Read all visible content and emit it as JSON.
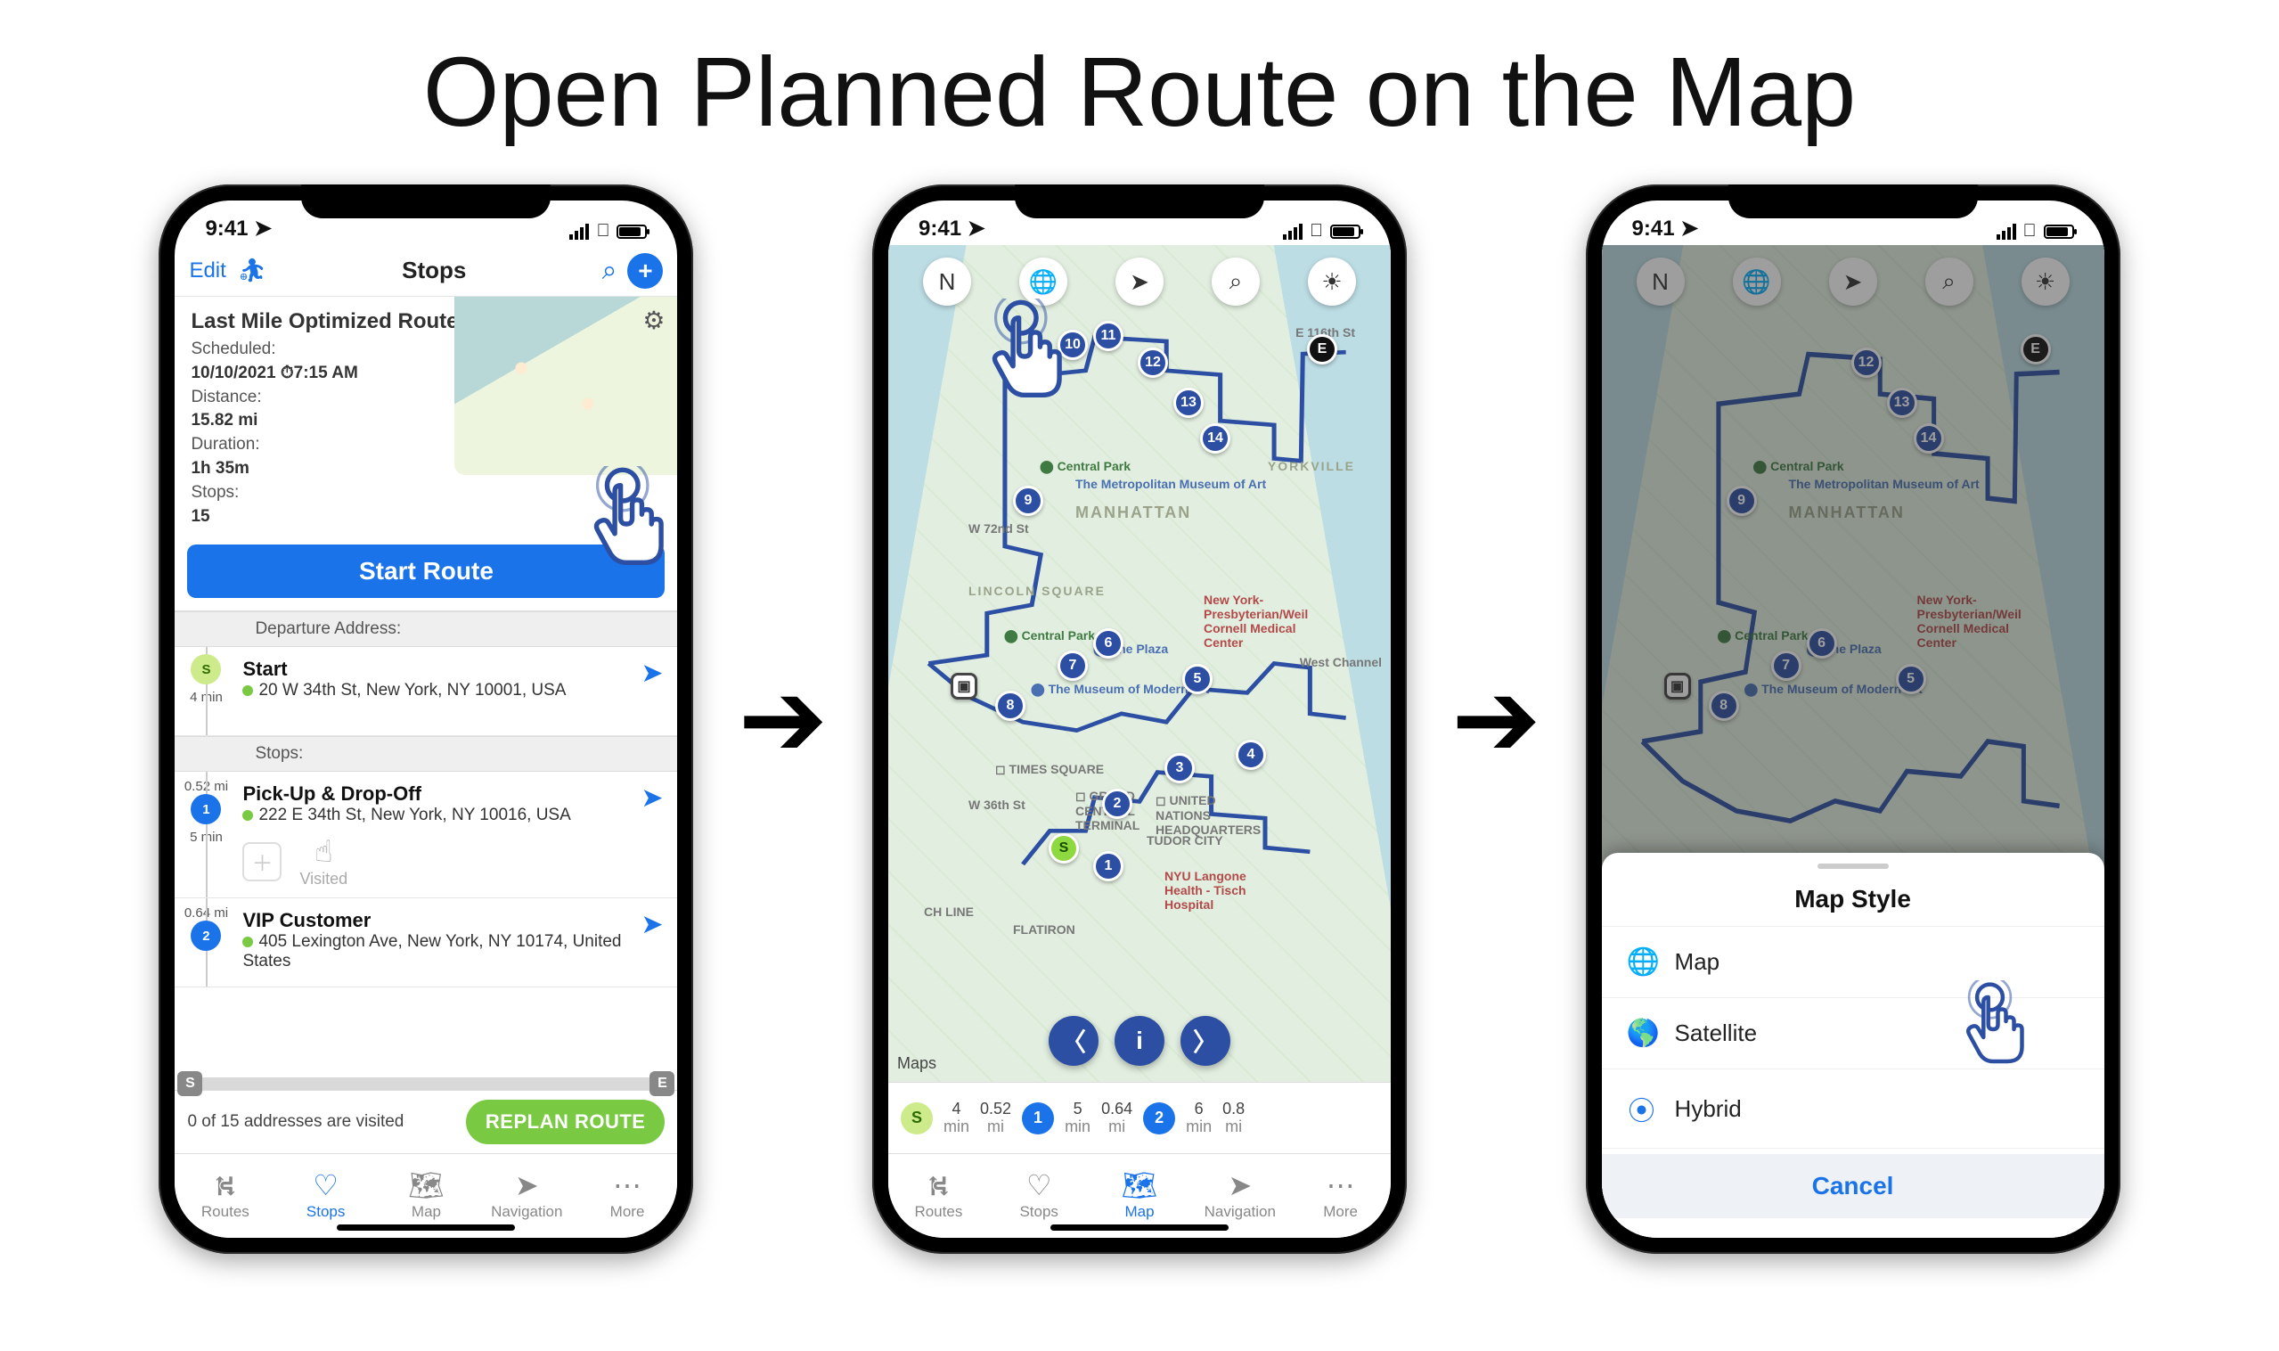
{
  "page_title": "Open Planned Route on the Map",
  "status": {
    "time": "9:41"
  },
  "screen1": {
    "toolbar": {
      "edit": "Edit",
      "title": "Stops"
    },
    "route": {
      "name": "Last Mile Optimized Route",
      "scheduled_label": "Scheduled:",
      "scheduled_date": "10/10/2021",
      "scheduled_time": "7:15 AM",
      "distance_label": "Distance:",
      "distance": "15.82 mi",
      "duration_label": "Duration:",
      "duration": "1h 35m",
      "stops_label": "Stops:",
      "stops": "15",
      "start_button": "Start Route"
    },
    "sections": {
      "departure": "Departure Address:",
      "stops": "Stops:"
    },
    "stops": [
      {
        "marker": "S",
        "time": "4 min",
        "dist": "",
        "name": "Start",
        "addr": "20 W 34th St, New York, NY 10001, USA"
      },
      {
        "marker": "1",
        "time": "5 min",
        "dist": "0.52 mi",
        "name": "Pick-Up & Drop-Off",
        "addr": "222 E 34th St, New York, NY 10016, USA",
        "visited_label": "Visited"
      },
      {
        "marker": "2",
        "time": "",
        "dist": "0.64 mi",
        "name": "VIP Customer",
        "addr": "405 Lexington Ave, New York, NY 10174, United States"
      }
    ],
    "footer": {
      "visited_msg": "0 of 15 addresses are visited",
      "replan": "REPLAN ROUTE"
    }
  },
  "map": {
    "attribution": "Maps",
    "region": "MANHATTAN",
    "yorkville": "YORKVILLE",
    "lincoln": "LINCOLN SQUARE",
    "pois": {
      "central_park": "Central Park",
      "met": "The Metropolitan Museum of Art",
      "cpzoo": "Central Park Zoo",
      "plaza": "The Plaza",
      "moma": "The Museum of Modern Art",
      "nypmc": "New York-Presbyterian/Weil Cornell Medical Center",
      "westchannel": "West Channel",
      "times_sq": "TIMES SQUARE",
      "gct": "GRAND CENTRAL TERMINAL",
      "un": "UNITED NATIONS HEADQUARTERS",
      "tudor": "TUDOR CITY",
      "nyulh": "NYU Langone Health - Tisch Hospital",
      "flatiron": "FLATIRON",
      "w72": "W 72nd St",
      "e116": "E 116th St",
      "w36": "W 36th St",
      "chline": "CH LINE"
    },
    "ticker": [
      {
        "t": "4",
        "u": "min"
      },
      {
        "t": "0.52",
        "u": "mi"
      },
      {
        "t": "5",
        "u": "min"
      },
      {
        "t": "0.64",
        "u": "mi"
      },
      {
        "t": "6",
        "u": "min"
      },
      {
        "t": "0.8",
        "u": "mi"
      }
    ]
  },
  "sheet": {
    "title": "Map Style",
    "options": [
      {
        "icon": "globe-icon",
        "label": "Map"
      },
      {
        "icon": "earth-icon",
        "label": "Satellite"
      },
      {
        "icon": "hybrid-icon",
        "label": "Hybrid"
      }
    ],
    "cancel": "Cancel"
  },
  "bottom_nav": {
    "routes": "Routes",
    "stops": "Stops",
    "map": "Map",
    "navigation": "Navigation",
    "more": "More"
  }
}
